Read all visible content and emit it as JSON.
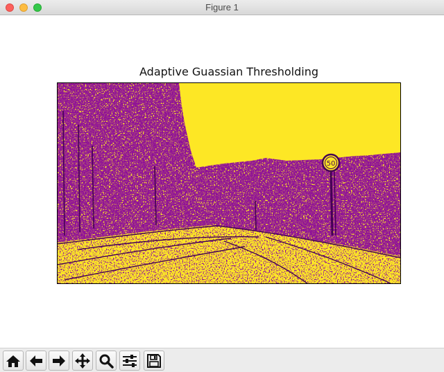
{
  "window": {
    "title": "Figure 1"
  },
  "figure": {
    "axes_title": "Adaptive Guassian Thresholding",
    "colormap": {
      "foreground": "#fde725",
      "background": "#440154"
    }
  },
  "toolbar": {
    "buttons": [
      {
        "name": "home",
        "icon": "home-icon"
      },
      {
        "name": "back",
        "icon": "arrow-left-icon"
      },
      {
        "name": "forward",
        "icon": "arrow-right-icon"
      },
      {
        "name": "pan",
        "icon": "move-icon"
      },
      {
        "name": "zoom",
        "icon": "magnifier-icon"
      },
      {
        "name": "configure-subplots",
        "icon": "sliders-icon"
      },
      {
        "name": "save",
        "icon": "floppy-disk-icon"
      }
    ]
  }
}
